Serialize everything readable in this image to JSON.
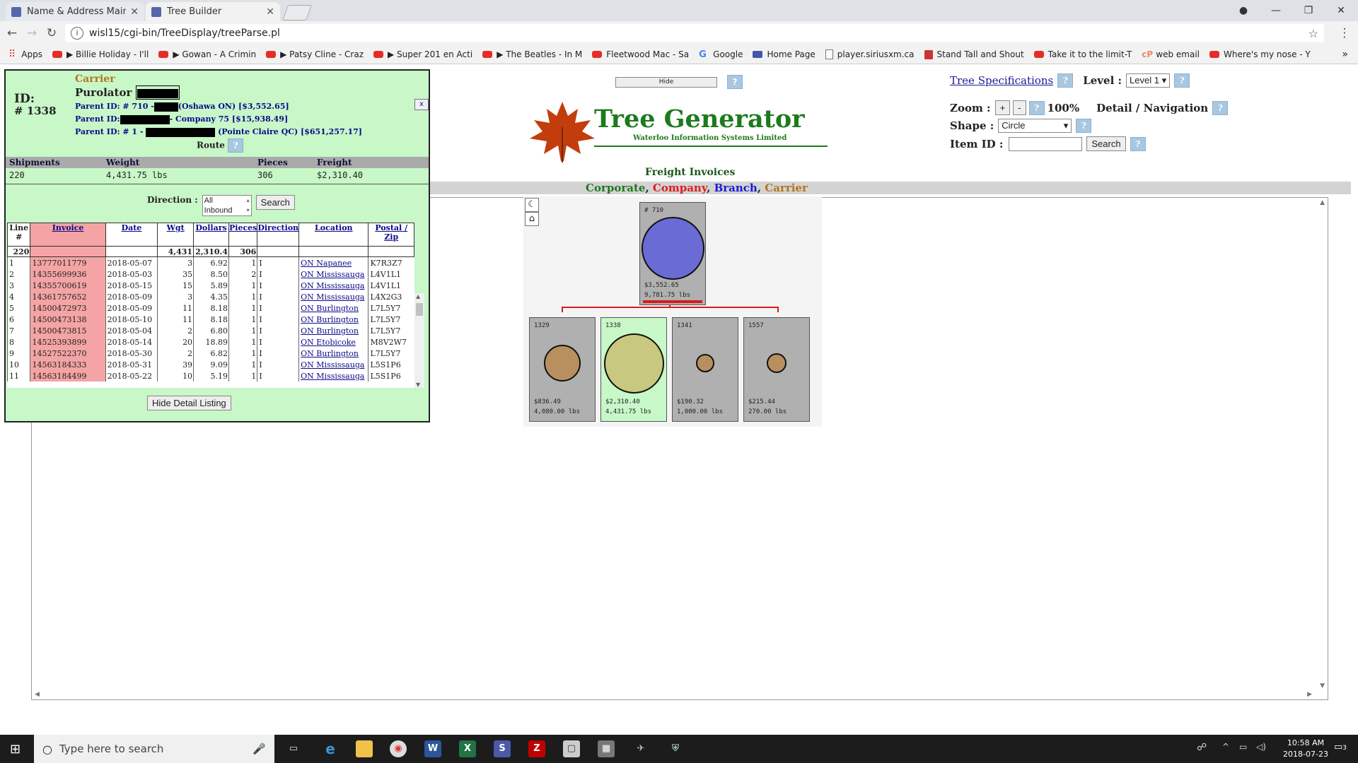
{
  "browser": {
    "tabs": [
      {
        "title": "Name & Address Mainte",
        "active": false
      },
      {
        "title": "Tree Builder",
        "active": true
      }
    ],
    "url": "wisl15/cgi-bin/TreeDisplay/treeParse.pl",
    "bookmarks": [
      "Apps",
      "▶ Billie Holiday - I'll",
      "▶ Gowan - A Crimin",
      "▶ Patsy Cline - Craz",
      "▶ Super 201 en Acti",
      "▶ The Beatles - In M",
      "Fleetwood Mac - Sa",
      "Google",
      "Home Page",
      "player.siriusxm.ca",
      "Stand Tall and Shout",
      "Take it to the limit-T",
      "web email",
      "Where's my nose - Y"
    ],
    "bookmarks_more": "»"
  },
  "header": {
    "hide_label": "Hide",
    "help": "?",
    "logo_title": "Tree Generator",
    "logo_sub": "Waterloo Information Systems Limited",
    "section_title": "Freight Invoices",
    "legend": [
      {
        "text": "Corporate",
        "color": "#1d7a1d"
      },
      {
        "text": "Company",
        "color": "#e01b1b"
      },
      {
        "text": "Branch",
        "color": "#1a1ad6"
      },
      {
        "text": "Carrier",
        "color": "#b5741f"
      }
    ],
    "legend_sep": ", "
  },
  "controls": {
    "tree_specs": "Tree Specifications",
    "level_label": "Level :",
    "level_value": "Level 1",
    "zoom_label": "Zoom :",
    "zoom_plus": "+",
    "zoom_minus": "-",
    "zoom_value": "100%",
    "detail_nav": "Detail / Navigation",
    "shape_label": "Shape :",
    "shape_value": "Circle",
    "itemid_label": "Item ID :",
    "itemid_value": "",
    "search_label": "Search"
  },
  "tree": {
    "root": {
      "id": "# 710",
      "amount": "$3,552.65",
      "weight": "9,781.75 lbs",
      "size": 0.95,
      "color": "#6b6bd6"
    },
    "children": [
      {
        "id": "1329",
        "amount": "$836.49",
        "weight": "4,080.00 lbs",
        "size": 0.55,
        "color": "#b89060",
        "selected": false
      },
      {
        "id": "1338",
        "amount": "$2,310.40",
        "weight": "4,431.75 lbs",
        "size": 0.9,
        "color": "#c8c880",
        "selected": true
      },
      {
        "id": "1341",
        "amount": "$190.32",
        "weight": "1,000.00 lbs",
        "size": 0.28,
        "color": "#b89060",
        "selected": false
      },
      {
        "id": "1557",
        "amount": "$215.44",
        "weight": "270.00 lbs",
        "size": 0.3,
        "color": "#b89060",
        "selected": false
      }
    ]
  },
  "detail": {
    "id_label": "ID:",
    "id_value": "# 1338",
    "type": "Carrier",
    "name": "Purolator",
    "parent1_pre": "Parent ID: # 710 -",
    "parent1_post": "(Oshawa ON) [$3,552.65]",
    "parent2_pre": "Parent ID:",
    "parent2_post": "- Company 75 [$15,938.49]",
    "parent3_pre": "Parent ID: # 1 -",
    "parent3_post": "(Pointe Claire QC) [$651,257.17]",
    "route": "Route",
    "close": "x",
    "summary_headers": [
      "Shipments",
      "Weight",
      "Pieces",
      "Freight"
    ],
    "summary_values": [
      "220",
      "4,431.75 lbs",
      "306",
      "$2,310.40"
    ],
    "direction_label": "Direction :",
    "direction_options": [
      "All",
      "Inbound"
    ],
    "search": "Search",
    "hide_detail": "Hide Detail Listing",
    "columns": [
      "Line #",
      "Invoice",
      "Date",
      "Wgt",
      "Dollars",
      "Pieces",
      "Direction",
      "Location",
      "Postal / Zip"
    ],
    "totals": [
      "220",
      "",
      "",
      "4,431",
      "2,310.4",
      "306",
      "",
      "",
      ""
    ],
    "rows": [
      [
        "1",
        "13777011779",
        "2018-05-07",
        "3",
        "6.92",
        "1",
        "I",
        "ON Napanee",
        "K7R3Z7"
      ],
      [
        "2",
        "14355699936",
        "2018-05-03",
        "35",
        "8.50",
        "2",
        "I",
        "ON Mississauga",
        "L4V1L1"
      ],
      [
        "3",
        "14355700619",
        "2018-05-15",
        "15",
        "5.89",
        "1",
        "I",
        "ON Mississauga",
        "L4V1L1"
      ],
      [
        "4",
        "14361757652",
        "2018-05-09",
        "3",
        "4.35",
        "1",
        "I",
        "ON Mississauga",
        "L4X2G3"
      ],
      [
        "5",
        "14500472973",
        "2018-05-09",
        "11",
        "8.18",
        "1",
        "I",
        "ON Burlington",
        "L7L5Y7"
      ],
      [
        "6",
        "14500473138",
        "2018-05-10",
        "11",
        "8.18",
        "1",
        "I",
        "ON Burlington",
        "L7L5Y7"
      ],
      [
        "7",
        "14500473815",
        "2018-05-04",
        "2",
        "6.80",
        "1",
        "I",
        "ON Burlington",
        "L7L5Y7"
      ],
      [
        "8",
        "14525393899",
        "2018-05-14",
        "20",
        "18.89",
        "1",
        "I",
        "ON Etobicoke",
        "M8V2W7"
      ],
      [
        "9",
        "14527522370",
        "2018-05-30",
        "2",
        "6.82",
        "1",
        "I",
        "ON Burlington",
        "L7L5Y7"
      ],
      [
        "10",
        "14563184333",
        "2018-05-31",
        "39",
        "9.09",
        "1",
        "I",
        "ON Mississauga",
        "L5S1P6"
      ],
      [
        "11",
        "14563184499",
        "2018-05-22",
        "10",
        "5.19",
        "1",
        "I",
        "ON Mississauga",
        "L5S1P6"
      ]
    ]
  },
  "taskbar": {
    "search_placeholder": "Type here to search",
    "time": "10:58 AM",
    "date": "2018-07-23",
    "notif_count": "3"
  }
}
